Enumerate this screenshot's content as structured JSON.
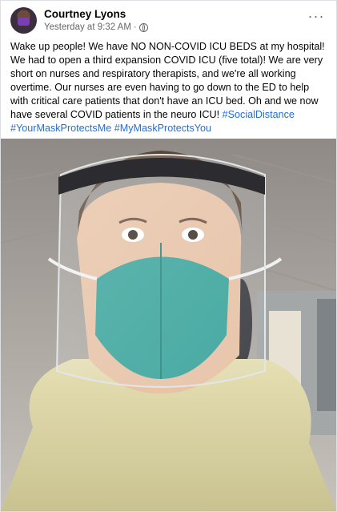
{
  "author": {
    "name": "Courtney Lyons",
    "timestamp": "Yesterday at 9:32 AM",
    "separator": "·",
    "privacy_icon": "globe-icon",
    "more_label": "···"
  },
  "post": {
    "body": "Wake up people! We have NO NON-COVID ICU BEDS at my hospital! We had to open a third expansion COVID ICU (five total)! We are very short on nurses and respiratory therapists, and we're all working overtime. Our nurses are even having to go down to the ED to help with critical care patients that don't have an ICU bed. Oh and we now have several COVID patients in the neuro ICU!",
    "hashtags": [
      "#SocialDistance",
      "#YourMaskProtectsMe",
      "#MyMaskProtectsYou"
    ]
  },
  "colors": {
    "link": "#216fdb",
    "meta": "#65676b",
    "mask": "#3aa59c"
  }
}
